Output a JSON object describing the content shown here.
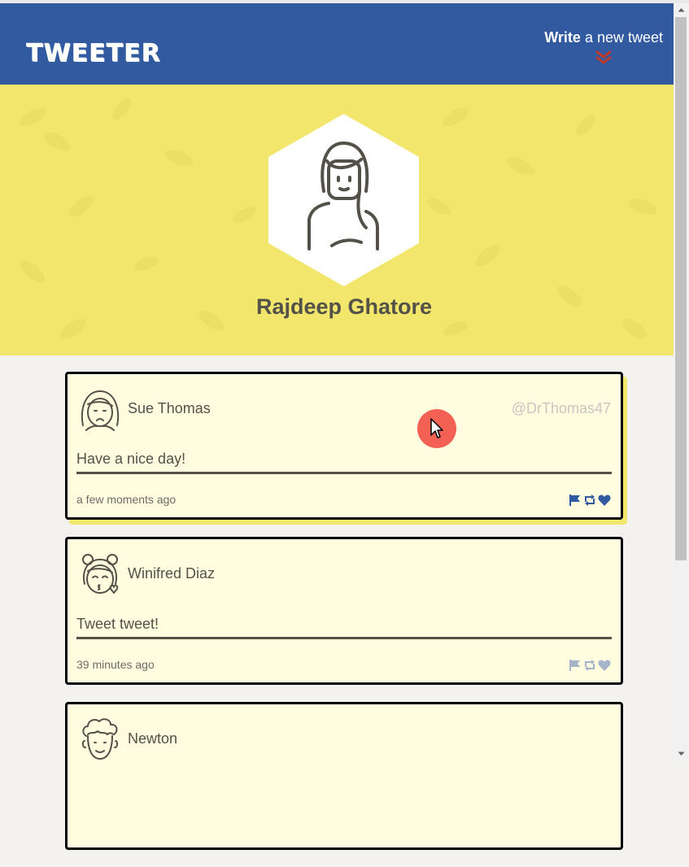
{
  "nav": {
    "logo": "TWEETER",
    "compose_strong": "Write",
    "compose_rest": " a new tweet"
  },
  "profile": {
    "name": "Rajdeep Ghatore"
  },
  "colors": {
    "nav_bg": "#325aa0",
    "header_bg": "#f2e66c",
    "tweet_bg": "#fffddf",
    "accent_red": "#c0392b",
    "icon_active": "#325aa0",
    "icon_inactive": "#a5b4c9"
  },
  "tweets": [
    {
      "name": "Sue Thomas",
      "handle": "@DrThomas47",
      "text": "Have a nice day!",
      "time": "a few moments ago",
      "avatar_icon": "girl-avatar-icon"
    },
    {
      "name": "Winifred Diaz",
      "handle": "",
      "text": "Tweet tweet!",
      "time": "39 minutes ago",
      "avatar_icon": "girl-kiss-avatar-icon"
    },
    {
      "name": "Newton",
      "handle": "",
      "text": "",
      "time": "",
      "avatar_icon": "curly-man-avatar-icon"
    }
  ],
  "icons": [
    "flag-icon",
    "retweet-icon",
    "heart-icon",
    "chevron-double-down-icon"
  ]
}
